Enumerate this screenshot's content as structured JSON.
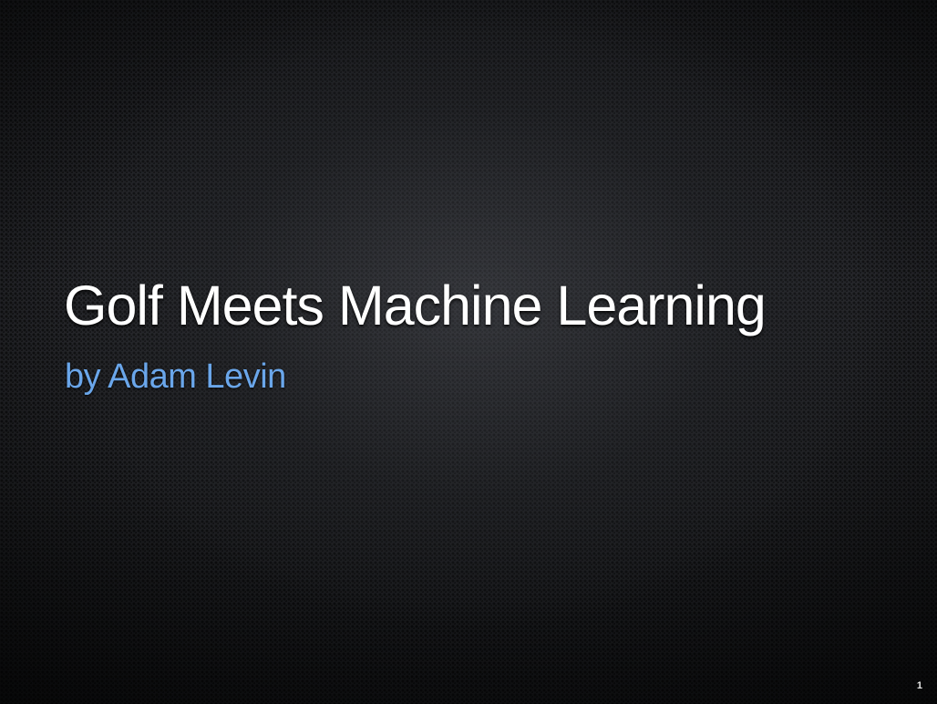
{
  "slide": {
    "title": "Golf Meets Machine Learning",
    "subtitle": "by Adam Levin",
    "page_number": "1"
  },
  "colors": {
    "title": "#ffffff",
    "subtitle": "#6aa6ea",
    "background": "#1f2023"
  }
}
